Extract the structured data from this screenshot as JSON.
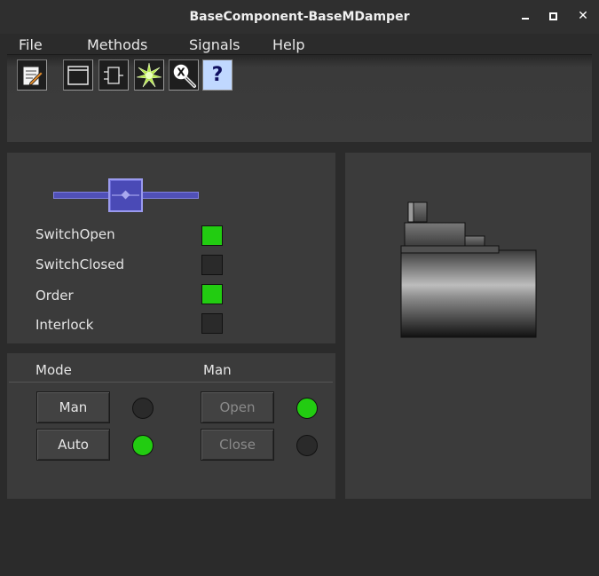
{
  "window": {
    "title": "BaseComponent-BaseMDamper",
    "minimize_icon": "minimize-icon",
    "maximize_icon": "maximize-icon",
    "close_glyph": "✕"
  },
  "menubar": {
    "items": [
      "File",
      "Methods",
      "Signals",
      "Help"
    ]
  },
  "toolbar": {
    "buttons": [
      {
        "icon": "notepad-icon"
      },
      {
        "icon": "window-icon"
      },
      {
        "icon": "component-icon"
      },
      {
        "icon": "spark-icon"
      },
      {
        "icon": "cross-reference-search-icon",
        "glyph": "X"
      },
      {
        "icon": "help-icon",
        "glyph": "?"
      }
    ]
  },
  "signals": {
    "slider_value": 0.5,
    "items": [
      {
        "label": "SwitchOpen",
        "state": "on"
      },
      {
        "label": "SwitchClosed",
        "state": "off"
      },
      {
        "label": "Order",
        "state": "on"
      },
      {
        "label": "Interlock",
        "state": "off"
      }
    ],
    "colors": {
      "on": "#22cc11",
      "off": "#2a2a2a"
    }
  },
  "mode": {
    "mode_header": "Mode",
    "man_header": "Man",
    "man_button": "Man",
    "auto_button": "Auto",
    "open_button": "Open",
    "close_button": "Close",
    "man_lamp": "off",
    "auto_lamp": "on",
    "open_lamp": "on",
    "close_lamp": "off"
  },
  "graphic": {
    "icon": "damper-actuator-icon"
  }
}
